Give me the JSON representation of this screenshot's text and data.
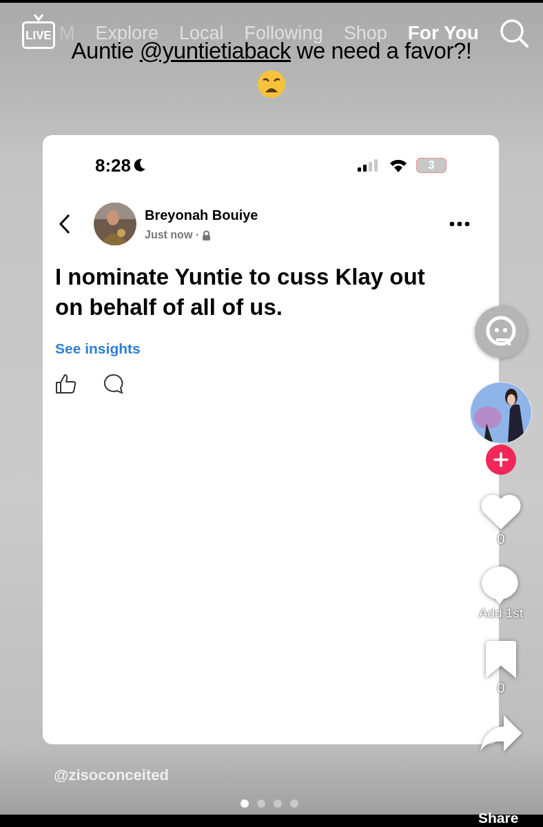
{
  "top_nav": {
    "live_label": "LIVE",
    "tabs": [
      {
        "label": "M",
        "selected": false,
        "faded": true
      },
      {
        "label": "Explore",
        "selected": false,
        "faded": false
      },
      {
        "label": "Local",
        "selected": false,
        "faded": false
      },
      {
        "label": "Following",
        "selected": false,
        "faded": false
      },
      {
        "label": "Shop",
        "selected": false,
        "faded": false
      },
      {
        "label": "For You",
        "selected": true,
        "faded": false
      }
    ]
  },
  "caption": {
    "before": "Auntie ",
    "mention": "@yuntietiaback",
    "after": " we need a favor?!"
  },
  "post_screenshot": {
    "status_bar": {
      "time": "8:28",
      "battery": "3"
    },
    "author": "Breyonah Bouiye",
    "meta": "Just now ·",
    "body": "I nominate Yuntie to cuss Klay out on behalf of all of us.",
    "insights_link": "See insights"
  },
  "side_rail": {
    "likes": "0",
    "comments": "Add 1st",
    "saves": "0",
    "share": "Share"
  },
  "username": "@zisoconceited",
  "page_dots": [
    {
      "selected": true
    },
    {
      "selected": false
    },
    {
      "selected": false
    },
    {
      "selected": false
    }
  ]
}
